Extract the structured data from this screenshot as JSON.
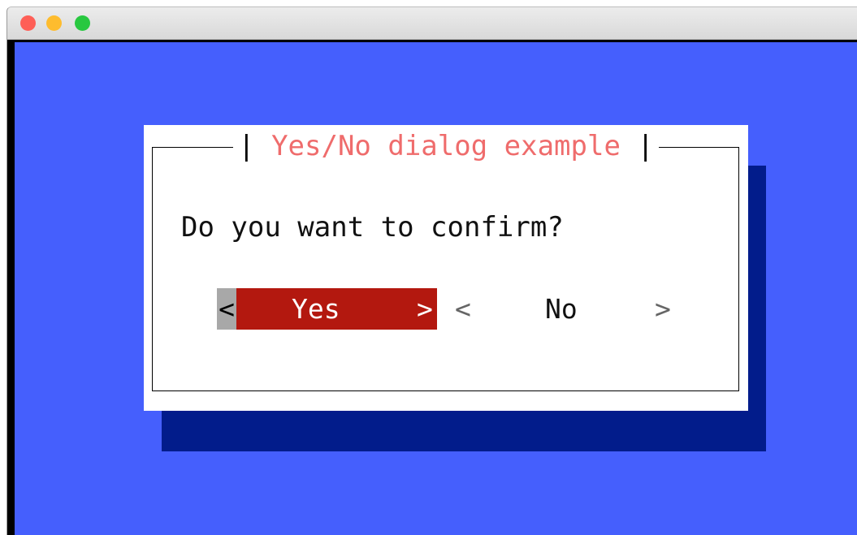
{
  "window": {
    "traffic_lights": {
      "close_color": "#fe5f57",
      "minimize_color": "#febc2e",
      "zoom_color": "#28c840"
    }
  },
  "terminal": {
    "background_color": "#455ffd"
  },
  "dialog": {
    "title_left_bar": "|",
    "title": "Yes/No dialog example",
    "title_right_bar": "|",
    "title_color": "#ef6c6c",
    "message": "Do you want to confirm?",
    "buttons": [
      {
        "left_bracket": "<",
        "label": "Yes",
        "right_bracket": ">",
        "selected": true,
        "highlight_color": "#b3180f"
      },
      {
        "left_bracket": "<",
        "label": "No",
        "right_bracket": ">",
        "selected": false
      }
    ]
  }
}
